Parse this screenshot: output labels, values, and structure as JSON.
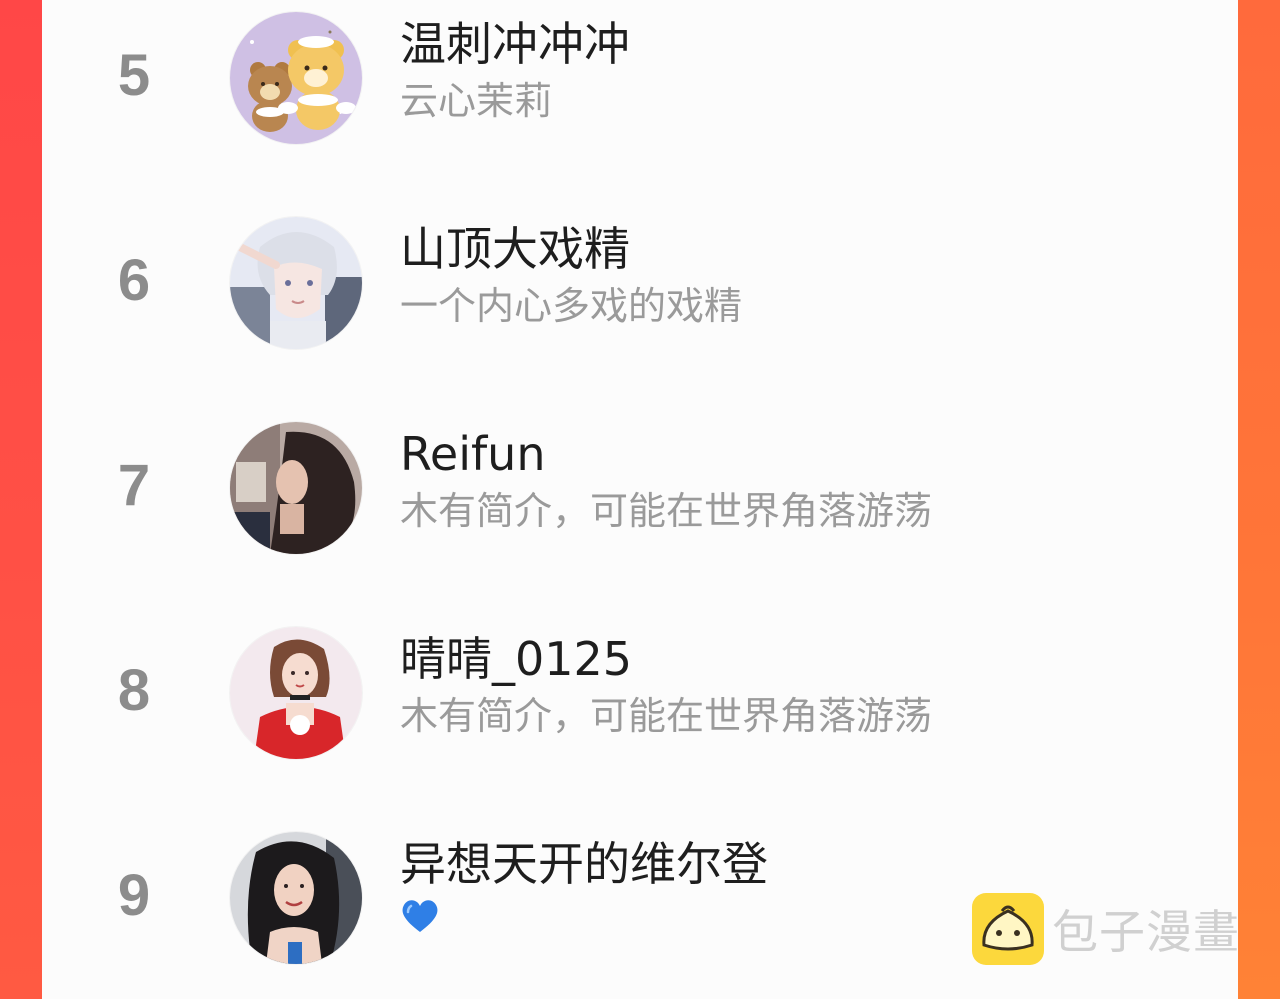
{
  "ranking": [
    {
      "rank": "5",
      "name": "温刺冲冲冲",
      "bio": "云心茉莉"
    },
    {
      "rank": "6",
      "name": "山顶大戏精",
      "bio": "一个内心多戏的戏精"
    },
    {
      "rank": "7",
      "name": "Reifun",
      "bio": "木有简介，可能在世界角落游荡"
    },
    {
      "rank": "8",
      "name": "晴晴_0125",
      "bio": "木有简介，可能在世界角落游荡"
    },
    {
      "rank": "9",
      "name": "异想天开的维尔登",
      "bio": "",
      "bio_icon": "blue-heart-emoji"
    }
  ],
  "watermark": {
    "text": "包子漫畫",
    "icon": "bun-mascot-icon"
  },
  "colors": {
    "frame": "#ff5a40",
    "card": "#fcfcfc",
    "rank_text": "#8c8c8c",
    "name_text": "#1e1e1e",
    "bio_text": "#9a9a9a",
    "watermark_icon": "#fcd83c"
  }
}
